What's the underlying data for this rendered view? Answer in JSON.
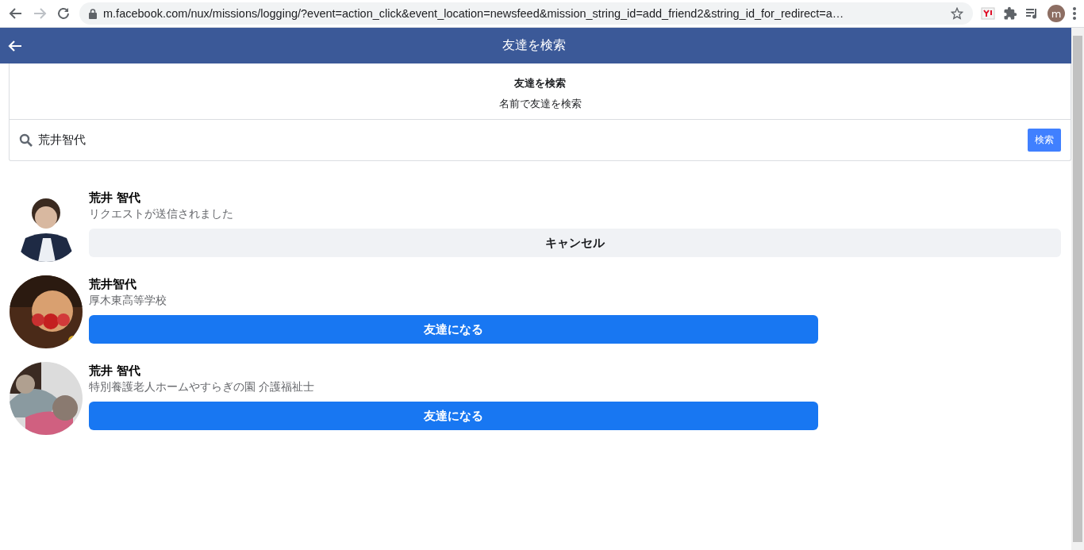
{
  "browser": {
    "url": "m.facebook.com/nux/missions/logging/?event=action_click&event_location=newsfeed&mission_string_id=add_friend2&string_id_for_redirect=a…",
    "forward_disabled": true,
    "profile_initial": "m"
  },
  "header": {
    "title": "友達を検索"
  },
  "intro": {
    "title": "友達を検索",
    "subtitle": "名前で友達を検索"
  },
  "search": {
    "value": "荒井智代",
    "button": "検索"
  },
  "results": [
    {
      "name": "荒井 智代",
      "detail": "リクエストが送信されました",
      "button": {
        "kind": "cancel",
        "label": "キャンセル"
      }
    },
    {
      "name": "荒井智代",
      "detail": "厚木東高等学校",
      "button": {
        "kind": "add",
        "label": "友達になる"
      }
    },
    {
      "name": "荒井 智代",
      "detail": "特別養護老人ホームやすらぎの園 介護福祉士",
      "button": {
        "kind": "add",
        "label": "友達になる"
      }
    }
  ]
}
